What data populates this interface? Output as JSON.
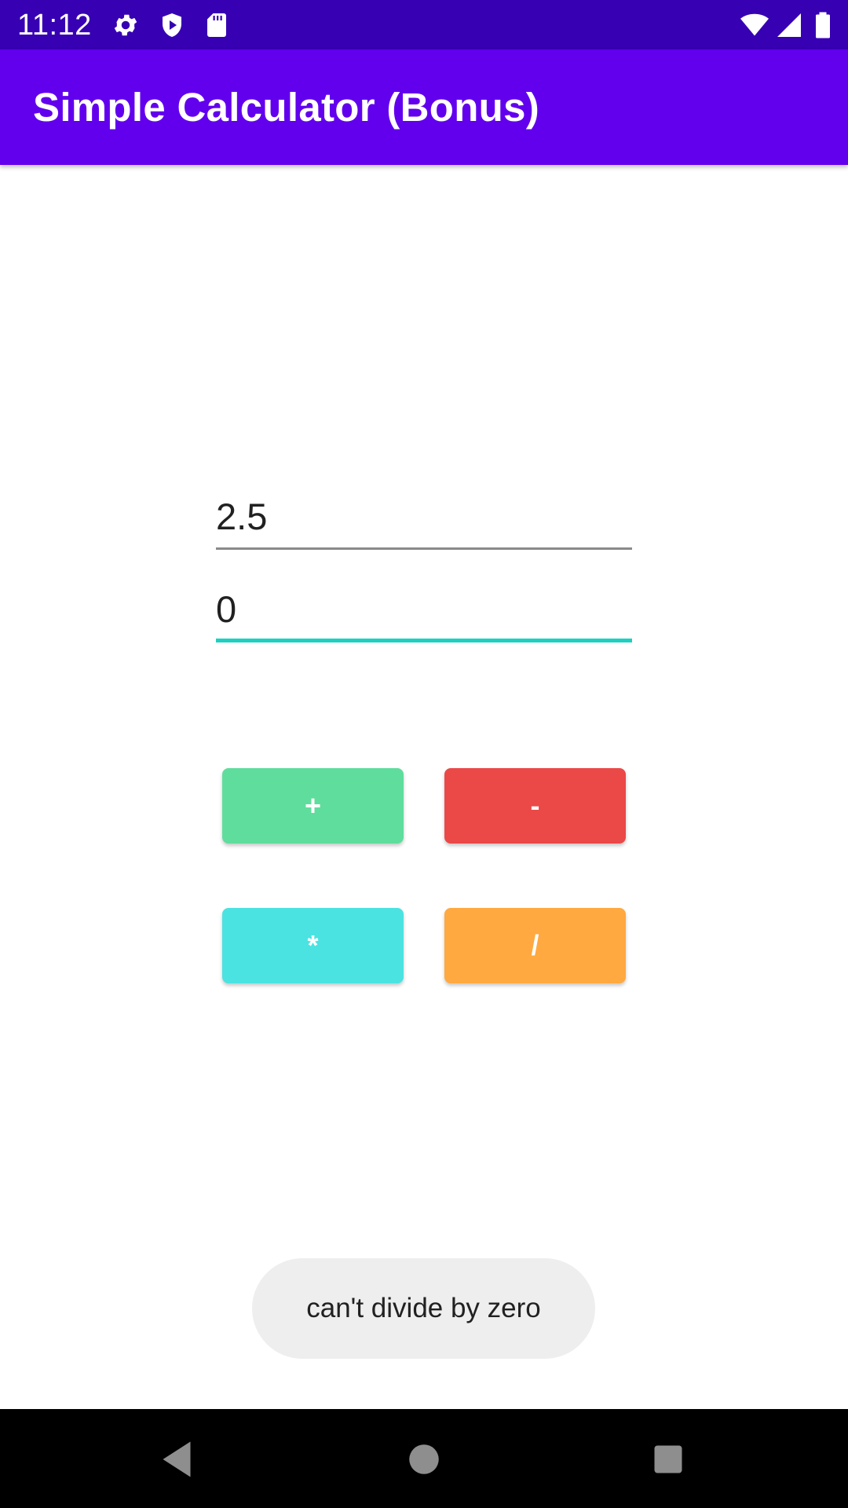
{
  "status_bar": {
    "time": "11:12",
    "background": "#3700b3",
    "left_icons": [
      "settings-icon",
      "shield-play-icon",
      "sd-card-icon"
    ],
    "right_icons": [
      "wifi-icon",
      "cell-signal-icon",
      "battery-icon"
    ]
  },
  "app_bar": {
    "title": "Simple Calculator (Bonus)",
    "background": "#6200ee"
  },
  "inputs": {
    "first_value": "2.5",
    "second_value": "0",
    "focused_underline_color": "#1dd1c1"
  },
  "buttons": {
    "add": {
      "label": "+",
      "color": "#5fdd9d"
    },
    "subtract": {
      "label": "-",
      "color": "#eb4848"
    },
    "multiply": {
      "label": "*",
      "color": "#4ae3e1"
    },
    "divide": {
      "label": "/",
      "color": "#ffa940"
    }
  },
  "toast": {
    "message": "can't divide by zero"
  },
  "nav_bar": {
    "icons": [
      "back-icon",
      "home-icon",
      "recents-icon"
    ]
  }
}
